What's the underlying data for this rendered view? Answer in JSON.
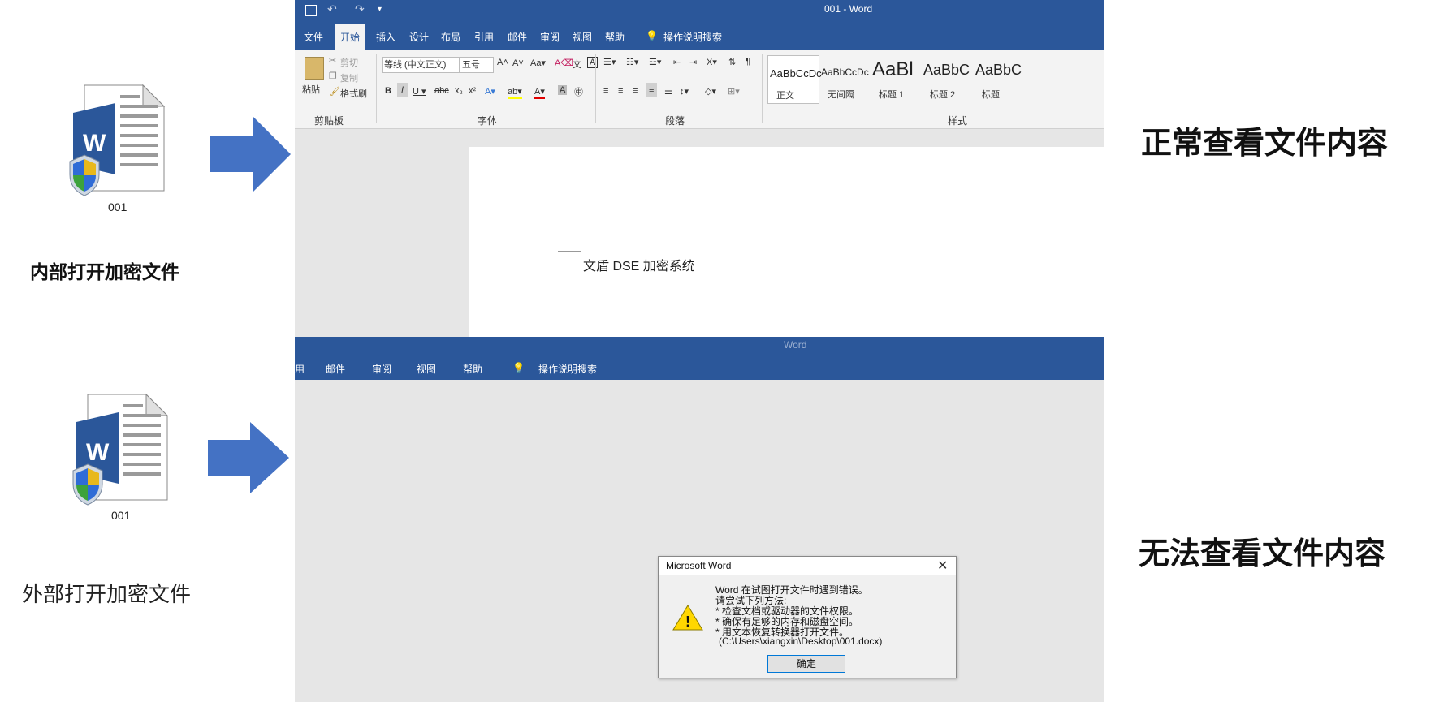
{
  "left_panel": {
    "top_file_name": "001",
    "top_caption": "内部打开加密文件",
    "bottom_file_name": "001",
    "bottom_caption": "外部打开加密文件"
  },
  "results": {
    "top": "正常查看文件内容",
    "bottom": "无法查看文件内容"
  },
  "word_top": {
    "window_title": "001 - Word",
    "tabs": [
      "文件",
      "开始",
      "插入",
      "设计",
      "布局",
      "引用",
      "邮件",
      "审阅",
      "视图",
      "帮助"
    ],
    "tell_me": "操作说明搜索",
    "clipboard": {
      "paste": "粘贴",
      "cut": "剪切",
      "copy": "复制",
      "format_painter": "格式刷",
      "group": "剪贴板"
    },
    "font": {
      "name": "等线 (中文正文)",
      "size": "五号",
      "group": "字体"
    },
    "paragraph_group": "段落",
    "styles": [
      {
        "sample": "AaBbCcDc",
        "name": "正文"
      },
      {
        "sample": "AaBbCcDc",
        "name": "无间隔"
      },
      {
        "sample": "AaBl",
        "name": "标题 1"
      },
      {
        "sample": "AaBbC",
        "name": "标题 2"
      },
      {
        "sample": "AaBbC",
        "name": "标题"
      }
    ],
    "styles_group": "样式",
    "document_text": "文盾 DSE 加密系统"
  },
  "word_bottom": {
    "window_title": "Word",
    "tabs": [
      "用",
      "邮件",
      "审阅",
      "视图",
      "帮助"
    ],
    "tell_me": "操作说明搜索",
    "dialog": {
      "title": "Microsoft Word",
      "lines": [
        "Word 在试图打开文件时遇到错误。",
        "请尝试下列方法:",
        "* 检查文档或驱动器的文件权限。",
        "* 确保有足够的内存和磁盘空间。",
        "* 用文本恢复转换器打开文件。",
        "(C:\\Users\\xiangxin\\Desktop\\001.docx)"
      ],
      "ok": "确定"
    }
  },
  "colors": {
    "word_blue": "#2b579a",
    "arrow_blue": "#4472c4",
    "warning_yellow": "#ffd700"
  }
}
